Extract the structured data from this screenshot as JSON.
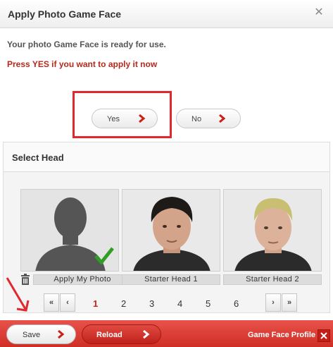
{
  "dialog": {
    "title": "Apply Photo Game Face",
    "message": "Your photo Game Face is ready for use.",
    "prompt": "Press YES if you want to apply it now"
  },
  "confirm": {
    "yes_label": "Yes",
    "no_label": "No"
  },
  "select_head": {
    "title": "Select Head",
    "heads": [
      {
        "label": "Apply My Photo",
        "selected": true
      },
      {
        "label": "Starter Head 1",
        "selected": false
      },
      {
        "label": "Starter Head 2",
        "selected": false
      }
    ]
  },
  "pagination": {
    "first": "«",
    "prev": "‹",
    "next": "›",
    "last": "»",
    "pages": [
      "1",
      "2",
      "3",
      "4",
      "5",
      "6"
    ],
    "current": "1"
  },
  "footer": {
    "save_label": "Save",
    "reload_label": "Reload",
    "profile_label": "Game Face Profile"
  },
  "colors": {
    "accent": "#cf2e26",
    "prompt_red": "#b8281a",
    "highlight_red": "#e0282e",
    "check_green": "#2f9e23"
  },
  "icons": {
    "close": "close-icon",
    "trash": "trash-icon",
    "check": "checkmark-icon",
    "chevron": "chevron-right-icon"
  }
}
